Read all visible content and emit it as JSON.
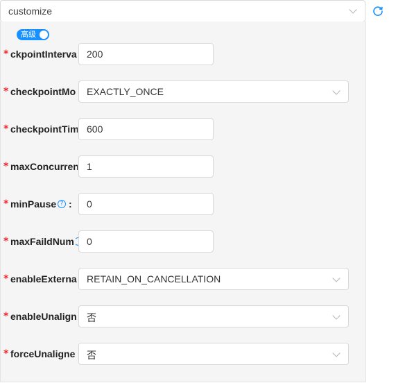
{
  "top_select": {
    "value": "customize"
  },
  "advanced_toggle": {
    "label": "高级",
    "on": true
  },
  "fields": [
    {
      "label": "ckpointInterva",
      "value": "200"
    },
    {
      "label": "checkpointMo",
      "value": "EXACTLY_ONCE"
    },
    {
      "label": "checkpointTim",
      "value": "600"
    },
    {
      "label": "maxConcurren",
      "value": "1"
    },
    {
      "label": "minPause",
      "colon": ":",
      "value": "0"
    },
    {
      "label": "maxFaildNum",
      "value": "0"
    },
    {
      "label": "enableExterna",
      "value": "RETAIN_ON_CANCELLATION"
    },
    {
      "label": "enableUnalign",
      "value": "否"
    },
    {
      "label": "forceUnaligne",
      "value": "否"
    }
  ],
  "required_mark": "*",
  "help_mark": "?",
  "colors": {
    "accent": "#1890ff",
    "required": "#f5222d",
    "panel_bg": "#f5f5f5"
  },
  "icons": [
    "refresh-icon",
    "chevron-down-icon",
    "question-circle-icon"
  ]
}
